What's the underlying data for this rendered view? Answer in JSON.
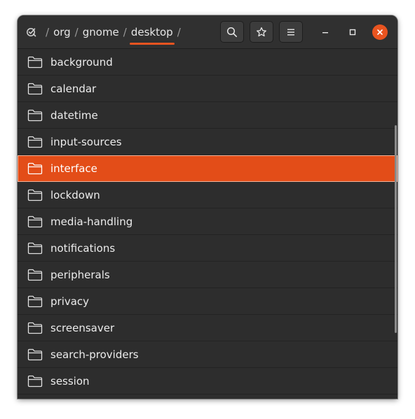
{
  "header": {
    "app_icon": "dconf-check-icon",
    "path": [
      {
        "label": "org"
      },
      {
        "label": "gnome"
      },
      {
        "label": "desktop"
      }
    ],
    "separator": "/",
    "buttons": {
      "search": "search-icon",
      "bookmark": "star-icon",
      "menu": "hamburger-menu-icon"
    },
    "window_controls": [
      "minimize-icon",
      "maximize-icon",
      "close-icon"
    ]
  },
  "items": [
    {
      "label": "background",
      "selected": false
    },
    {
      "label": "calendar",
      "selected": false
    },
    {
      "label": "datetime",
      "selected": false
    },
    {
      "label": "input-sources",
      "selected": false
    },
    {
      "label": "interface",
      "selected": true
    },
    {
      "label": "lockdown",
      "selected": false
    },
    {
      "label": "media-handling",
      "selected": false
    },
    {
      "label": "notifications",
      "selected": false
    },
    {
      "label": "peripherals",
      "selected": false
    },
    {
      "label": "privacy",
      "selected": false
    },
    {
      "label": "screensaver",
      "selected": false
    },
    {
      "label": "search-providers",
      "selected": false
    },
    {
      "label": "session",
      "selected": false
    }
  ],
  "colors": {
    "accent": "#e95420",
    "selection": "#e34d18",
    "background": "#2d2d2d",
    "text": "#ececec"
  }
}
